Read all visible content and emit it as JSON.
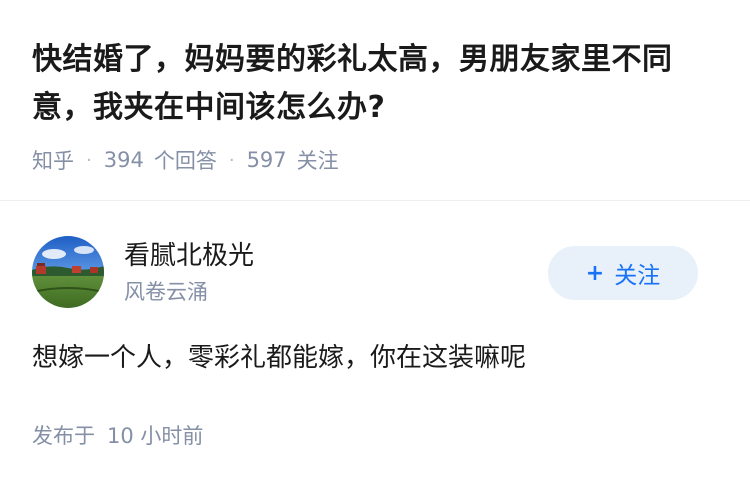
{
  "question": {
    "title": "快结婚了，妈妈要的彩礼太高，男朋友家里不同意，我夹在中间该怎么办?",
    "source": "知乎",
    "answer_count": "394",
    "answer_label": "个回答",
    "follower_count": "597",
    "follower_label": "关注"
  },
  "author": {
    "name": "看腻北极光",
    "signature": "风卷云涌",
    "avatar_icon": "avatar-landscape-photo",
    "follow_label": "关注",
    "follow_icon": "plus-icon"
  },
  "answer": {
    "content": "想嫁一个人，零彩礼都能嫁，你在这装嘛呢"
  },
  "footer": {
    "published_label": "发布于",
    "published_time": "10 小时前"
  },
  "colors": {
    "meta_gray": "#8590a6",
    "accent_blue": "#1772f6",
    "follow_bg": "#e8f0fa"
  }
}
